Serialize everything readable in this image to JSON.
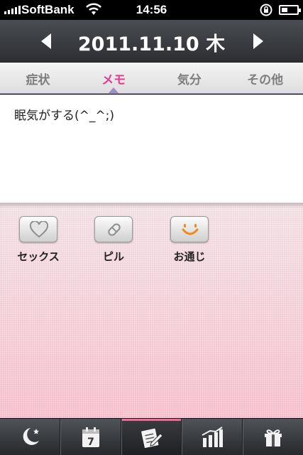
{
  "status": {
    "carrier": "SoftBank",
    "time": "14:56",
    "icons": [
      "signal-bars-icon",
      "wifi-icon",
      "rotation-lock-icon",
      "battery-icon"
    ]
  },
  "header": {
    "date": "2011.11.10 木",
    "prev_icon": "left-arrow-icon",
    "next_icon": "right-arrow-icon"
  },
  "tabs": [
    {
      "label": "症状",
      "active": false
    },
    {
      "label": "メモ",
      "active": true
    },
    {
      "label": "気分",
      "active": false
    },
    {
      "label": "その他",
      "active": false
    }
  ],
  "memo": {
    "text": "眠気がする(^_^;)"
  },
  "toggles": [
    {
      "label": "セックス",
      "icon": "heart-icon"
    },
    {
      "label": "ピル",
      "icon": "pill-icon"
    },
    {
      "label": "お通じ",
      "icon": "smiley-icon"
    }
  ],
  "tabbar": {
    "items": [
      {
        "icon": "moon-star-icon",
        "active": false
      },
      {
        "icon": "calendar-icon",
        "active": false
      },
      {
        "icon": "notepad-pencil-icon",
        "active": true
      },
      {
        "icon": "bar-chart-icon",
        "active": false
      },
      {
        "icon": "gift-icon",
        "active": false
      }
    ],
    "calendar_day": "7"
  },
  "colors": {
    "accent": "#e23e8e",
    "active_indicator": "#ef6b96",
    "smiley": "#f08a1c"
  }
}
